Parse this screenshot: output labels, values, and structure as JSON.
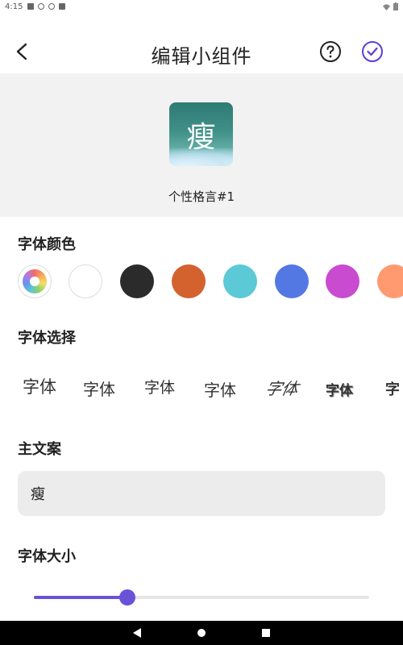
{
  "status_bar": {
    "time": "4:15"
  },
  "app_bar": {
    "title": "编辑小组件",
    "back_icon": "chevron-left-icon",
    "help_icon": "help-circle-icon",
    "confirm_icon": "check-circle-icon",
    "accent": "#5b3fd6"
  },
  "preview": {
    "widget_glyph": "瘦",
    "widget_name": "个性格言#1"
  },
  "font_color": {
    "label": "字体颜色",
    "swatches": [
      "#ffffff",
      "#2b2b2b",
      "#d4622f",
      "#5bc9d6",
      "#5478e3",
      "#c94bd0",
      "#ff9a70"
    ]
  },
  "font_select": {
    "label": "字体选择",
    "options": [
      "字体",
      "字体",
      "字体",
      "字体",
      "字体",
      "字体",
      "字"
    ]
  },
  "main_text": {
    "label": "主文案",
    "value": "瘦"
  },
  "font_size": {
    "label": "字体大小",
    "slider_fraction": 0.28,
    "accent": "#6a52d8"
  }
}
